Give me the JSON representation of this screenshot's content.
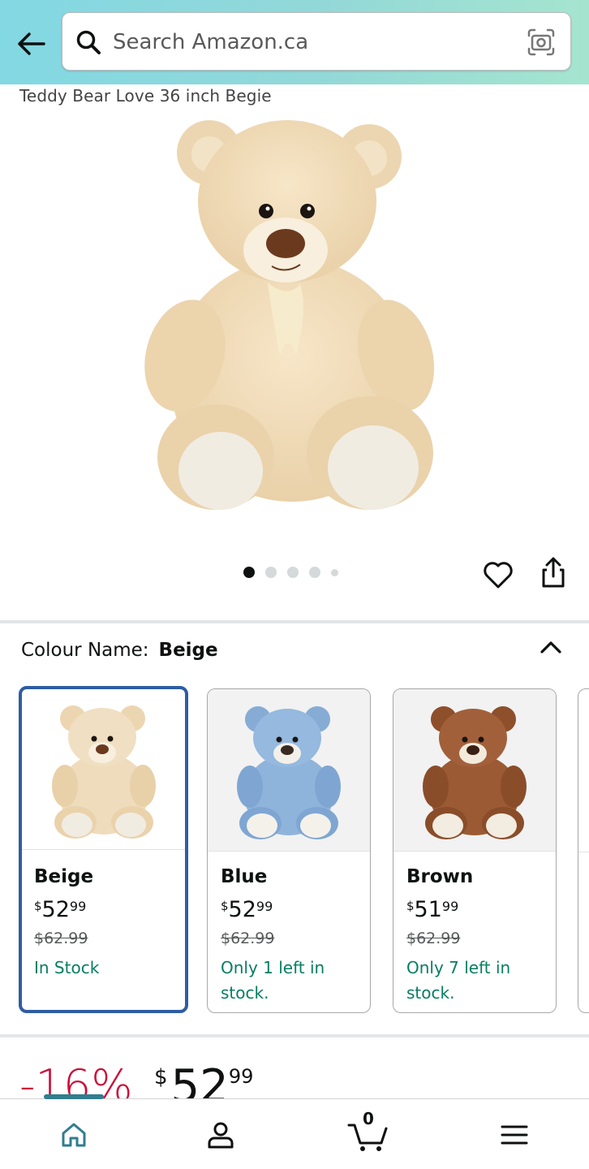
{
  "search": {
    "placeholder": "Search Amazon.ca"
  },
  "product": {
    "title": "Teddy Bear Love 36 inch Begie",
    "image_count": 5,
    "active_image_index": 0
  },
  "colour": {
    "label": "Colour Name:",
    "selected": "Beige"
  },
  "swatches": [
    {
      "name": "Beige",
      "currency": "$",
      "price_whole": "52",
      "price_cents": "99",
      "was_price": "$62.99",
      "stock": "In Stock",
      "color": "#efdcbc"
    },
    {
      "name": "Blue",
      "currency": "$",
      "price_whole": "52",
      "price_cents": "99",
      "was_price": "$62.99",
      "stock": "Only 1 left in stock.",
      "color": "#8fb4dc"
    },
    {
      "name": "Brown",
      "currency": "$",
      "price_whole": "51",
      "price_cents": "99",
      "was_price": "$62.99",
      "stock": "Only 7 left in stock.",
      "color": "#9b5a33"
    }
  ],
  "price_block": {
    "discount": "-16%",
    "currency": "$",
    "whole": "52",
    "cents": "99"
  },
  "nav": {
    "cart_count": "0",
    "active": "home"
  },
  "colors": {
    "header_gradient_start": "#82d8e3",
    "header_gradient_end": "#a5e5cf",
    "selected_border": "#2e5da2",
    "stock_green": "#067d62",
    "discount_red": "#cc0c39",
    "nav_accent": "#2f7e8f"
  }
}
